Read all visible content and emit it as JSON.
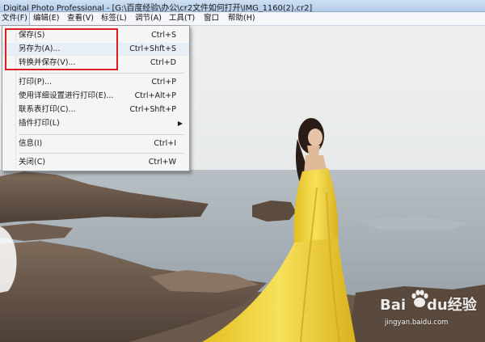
{
  "window": {
    "title": "Digital Photo Professional - [G:\\百度经验\\办公\\cr2文件如何打开\\IMG_1160(2).cr2]"
  },
  "menubar": [
    {
      "label": "文件(F)"
    },
    {
      "label": "编辑(E)"
    },
    {
      "label": "查看(V)"
    },
    {
      "label": "标签(L)"
    },
    {
      "label": "调节(A)"
    },
    {
      "label": "工具(T)"
    },
    {
      "label": "窗口"
    },
    {
      "label": "帮助(H)"
    }
  ],
  "file_menu": {
    "save": {
      "label": "保存(S)",
      "shortcut": "Ctrl+S"
    },
    "save_as": {
      "label": "另存为(A)...",
      "shortcut": "Ctrl+Shft+S"
    },
    "convert_save": {
      "label": "转换并保存(V)...",
      "shortcut": "Ctrl+D"
    },
    "print": {
      "label": "打印(P)...",
      "shortcut": "Ctrl+P"
    },
    "print_detailed": {
      "label": "使用详细设置进行打印(E)...",
      "shortcut": "Ctrl+Alt+P"
    },
    "contact_sheet": {
      "label": "联系表打印(C)...",
      "shortcut": "Ctrl+Shft+P"
    },
    "plugin_print": {
      "label": "插件打印(L)",
      "submenu_arrow": "▶"
    },
    "info": {
      "label": "信息(I)",
      "shortcut": "Ctrl+I"
    },
    "close": {
      "label": "关闭(C)",
      "shortcut": "Ctrl+W"
    }
  },
  "watermark": {
    "brand_left": "Bai",
    "brand_paw": "du",
    "brand_right": "经验",
    "url": "jingyan.baidu.com"
  },
  "colors": {
    "highlight_box": "#d81e1e",
    "dress": "#f2d43a",
    "sea": "#9aa7b0",
    "sky": "#e8eaea"
  }
}
